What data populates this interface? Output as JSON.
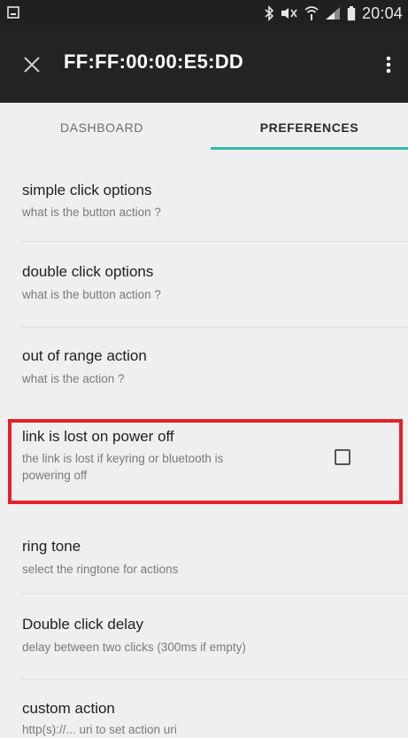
{
  "status_bar": {
    "time": "20:04",
    "icons": [
      "screenshot-icon",
      "bluetooth-icon",
      "mute-icon",
      "wifi-icon",
      "signal-icon",
      "battery-icon"
    ]
  },
  "app_bar": {
    "title": "FF:FF:00:00:E5:DD",
    "close_icon": "close-icon",
    "menu_icon": "overflow-menu-icon"
  },
  "tabs": [
    {
      "label": "DASHBOARD",
      "selected": false
    },
    {
      "label": "PREFERENCES",
      "selected": true
    }
  ],
  "colors": {
    "accent": "#2fb9a8",
    "highlight": "#e5202a",
    "app_bar": "#232323"
  },
  "preferences": [
    {
      "title": "simple click options",
      "summary": "what is the button action ?"
    },
    {
      "title": "double click options",
      "summary": "what is the button action ?"
    },
    {
      "title": "out of range action",
      "summary": "what is the action ?"
    },
    {
      "title": "link is lost on power off",
      "summary_line1": "the link is lost if keyring or bluetooth is",
      "summary_line2": "powering off",
      "checked": false
    },
    {
      "title": "ring tone",
      "summary": "select the ringtone for actions"
    },
    {
      "title": "Double click delay",
      "summary": "delay between two clicks (300ms if empty)"
    },
    {
      "title": "custom action",
      "summary": "http(s)://... uri to set action uri"
    }
  ]
}
